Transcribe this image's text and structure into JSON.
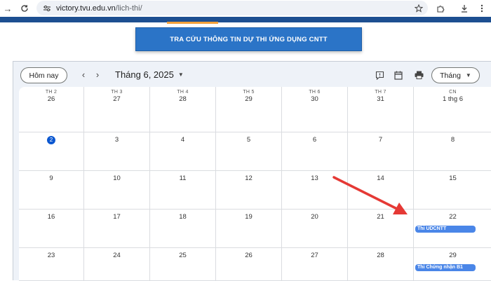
{
  "browser": {
    "url_host": "victory.tvu.edu.vn",
    "url_path": "/lich-thi/"
  },
  "banner": {
    "text": "TRA CỨU THÔNG TIN DỰ THI ỨNG DỤNG CNTT"
  },
  "calendar": {
    "today_label": "Hôm nay",
    "month_title": "Tháng 6, 2025",
    "view_label": "Tháng",
    "weekdays": [
      "TH 2",
      "TH 3",
      "TH 4",
      "TH 5",
      "TH 6",
      "TH 7",
      "CN"
    ],
    "weeks": [
      [
        "26",
        "27",
        "28",
        "29",
        "30",
        "31",
        "1 thg 6"
      ],
      [
        "2",
        "3",
        "4",
        "5",
        "6",
        "7",
        "8"
      ],
      [
        "9",
        "10",
        "11",
        "12",
        "13",
        "14",
        "15"
      ],
      [
        "16",
        "17",
        "18",
        "19",
        "20",
        "21",
        "22"
      ],
      [
        "23",
        "24",
        "25",
        "26",
        "27",
        "28",
        "29"
      ]
    ],
    "events": {
      "e22": "Thi UDCNTT",
      "e29": "Thi Chứng nhận B1"
    },
    "event_color": "#4a86e8",
    "today_color": "#0b57d0"
  },
  "annotation": {
    "arrow_color": "#e53935"
  }
}
